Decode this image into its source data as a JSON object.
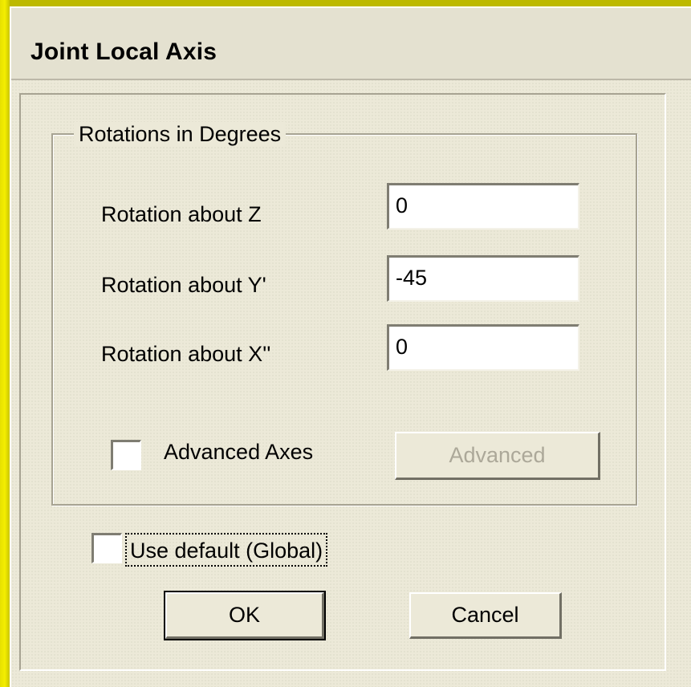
{
  "dialog": {
    "title": "Joint Local Axis"
  },
  "group": {
    "label": "Rotations in Degrees",
    "rows": [
      {
        "label": "Rotation about  Z",
        "value": "0"
      },
      {
        "label": "Rotation about  Y'",
        "value": "-45"
      },
      {
        "label": "Rotation about  X''",
        "value": "0"
      }
    ],
    "advanced_axes": {
      "label": "Advanced Axes",
      "checked": false
    },
    "advanced_button_label": "Advanced"
  },
  "use_default": {
    "label": "Use default  (Global)",
    "checked": false
  },
  "buttons": {
    "ok_label": "OK",
    "cancel_label": "Cancel"
  }
}
